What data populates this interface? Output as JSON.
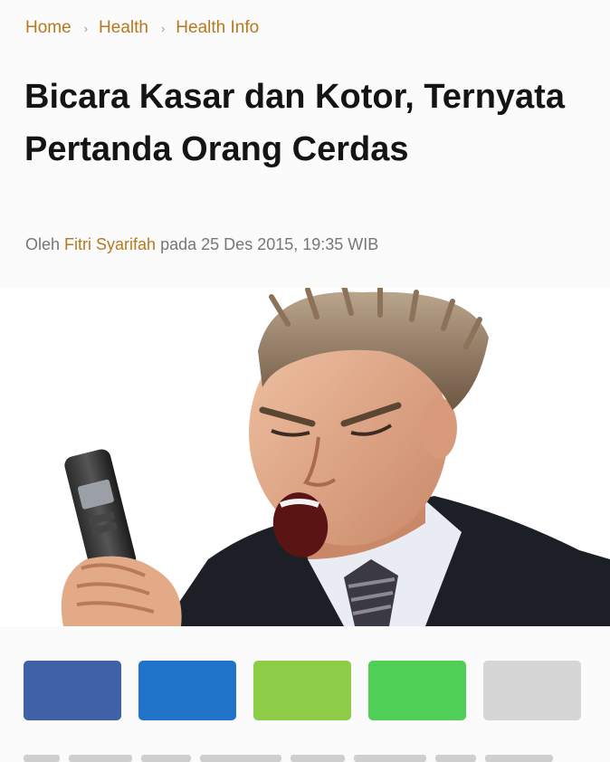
{
  "breadcrumb": {
    "items": [
      "Home",
      "Health",
      "Health Info"
    ],
    "separator": "›"
  },
  "article": {
    "title": "Bicara Kasar dan Kotor, Ternyata Pertanda Orang Cerdas",
    "byline_prefix": "Oleh",
    "author": "Fitri Syarifah",
    "byline_middle": "pada",
    "date": "25 Des 2015, 19:35 WIB"
  },
  "share": {
    "buttons": [
      {
        "name": "facebook",
        "icon": "facebook-icon",
        "color": "#3f62a6"
      },
      {
        "name": "twitter",
        "icon": "twitter-icon",
        "color": "#1f73c8"
      },
      {
        "name": "line",
        "icon": "line-icon",
        "color": "#8dcc46"
      },
      {
        "name": "whatsapp",
        "icon": "whatsapp-icon",
        "color": "#4fcf56"
      },
      {
        "name": "copy-link",
        "icon": "link-icon",
        "color": "#d6d6d6"
      }
    ]
  },
  "colors": {
    "accent": "#b7781e",
    "title": "#141414",
    "meta": "#767676"
  }
}
